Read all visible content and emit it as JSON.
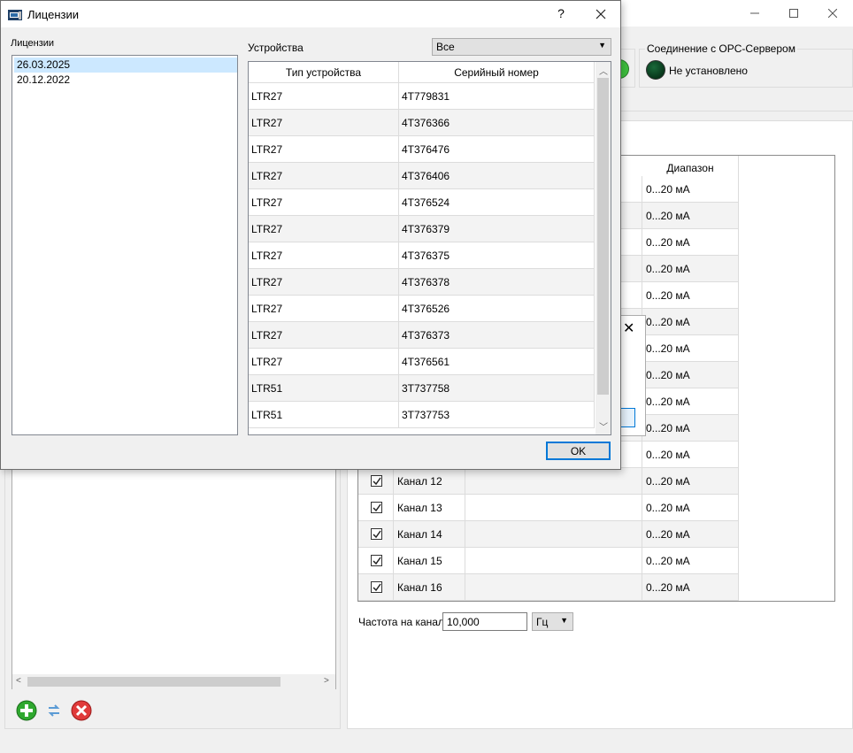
{
  "main": {
    "opc_group_title": "Соединение с OPC-Сервером",
    "opc_status": "Не установлено",
    "channels": {
      "range_header": "Диапазон",
      "rows": [
        {
          "name": "",
          "range": "0...20 мА"
        },
        {
          "name": "",
          "range": "0...20 мА"
        },
        {
          "name": "",
          "range": "0...20 мА"
        },
        {
          "name": "",
          "range": "0...20 мА"
        },
        {
          "name": "",
          "range": "0...20 мА"
        },
        {
          "name": "",
          "range": "0...20 мА"
        },
        {
          "name": "",
          "range": "0...20 мА"
        },
        {
          "name": "",
          "range": "0...20 мА"
        },
        {
          "name": "",
          "range": "0...20 мА"
        },
        {
          "name": "",
          "range": "0...20 мА"
        },
        {
          "name": "",
          "range": "0...20 мА"
        },
        {
          "name": "Канал 12",
          "range": "0...20 мА",
          "checked": true
        },
        {
          "name": "Канал 13",
          "range": "0...20 мА",
          "checked": true
        },
        {
          "name": "Канал 14",
          "range": "0...20 мА",
          "checked": true
        },
        {
          "name": "Канал 15",
          "range": "0...20 мА",
          "checked": true
        },
        {
          "name": "Канал 16",
          "range": "0...20 мА",
          "checked": true
        }
      ]
    },
    "freq_label": "Частота на канал",
    "freq_value": "10,000",
    "freq_unit": "Гц"
  },
  "dialog": {
    "title": "Лицензии",
    "help": "?",
    "licenses_label": "Лицензии",
    "licenses": [
      "26.03.2025",
      "20.12.2022"
    ],
    "selected_license": 0,
    "devices_label": "Устройства",
    "devices_filter": "Все",
    "table": {
      "col_type": "Тип устройства",
      "col_serial": "Серийный номер",
      "rows": [
        {
          "type": "LTR27",
          "serial": "4T779831"
        },
        {
          "type": "LTR27",
          "serial": "4T376366"
        },
        {
          "type": "LTR27",
          "serial": "4T376476"
        },
        {
          "type": "LTR27",
          "serial": "4T376406"
        },
        {
          "type": "LTR27",
          "serial": "4T376524"
        },
        {
          "type": "LTR27",
          "serial": "4T376379"
        },
        {
          "type": "LTR27",
          "serial": "4T376375"
        },
        {
          "type": "LTR27",
          "serial": "4T376378"
        },
        {
          "type": "LTR27",
          "serial": "4T376526"
        },
        {
          "type": "LTR27",
          "serial": "4T376373"
        },
        {
          "type": "LTR27",
          "serial": "4T376561"
        },
        {
          "type": "LTR51",
          "serial": "3T737758"
        },
        {
          "type": "LTR51",
          "serial": "3T737753"
        }
      ]
    },
    "ok_label": "OK"
  }
}
